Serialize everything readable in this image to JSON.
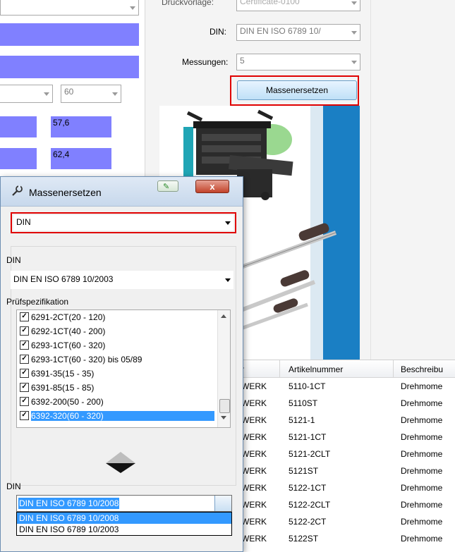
{
  "background": {
    "druckvorlage_label": "Druckvorlage:",
    "druckvorlage_value": "Certificate-0100",
    "din_label": "DIN:",
    "din_value": "DIN EN ISO 6789 10/",
    "messungen_label": "Messungen:",
    "messungen_value": "5",
    "massenersetzen_button": "Massenersetzen",
    "left_combo_value": "60",
    "left_values": [
      "57,6",
      "62,4"
    ]
  },
  "table": {
    "columns": [
      "r",
      "Artikelnummer",
      "Beschreibu"
    ],
    "rows": [
      {
        "c1": "WERK",
        "c2": "5110-1CT",
        "c3": "Drehmome"
      },
      {
        "c1": "WERK",
        "c2": "5110ST",
        "c3": "Drehmome"
      },
      {
        "c1": "WERK",
        "c2": "5121-1",
        "c3": "Drehmome"
      },
      {
        "c1": "WERK",
        "c2": "5121-1CT",
        "c3": "Drehmome"
      },
      {
        "c1": "WERK",
        "c2": "5121-2CLT",
        "c3": "Drehmome"
      },
      {
        "c1": "WERK",
        "c2": "5121ST",
        "c3": "Drehmome"
      },
      {
        "c1": "WERK",
        "c2": "5122-1CT",
        "c3": "Drehmome"
      },
      {
        "c1": "WERK",
        "c2": "5122-2CLT",
        "c3": "Drehmome"
      },
      {
        "c1": "WERK",
        "c2": "5122-2CT",
        "c3": "Drehmome"
      },
      {
        "c1": "WERK",
        "c2": "5122ST",
        "c3": "Drehmome"
      }
    ]
  },
  "dialog": {
    "title": "Massenersetzen",
    "close_label": "x",
    "type_select": "DIN",
    "source_label": "DIN",
    "source_value": "DIN EN ISO 6789 10/2003",
    "spec_label": "Prüfspezifikation",
    "specs": [
      "6291-2CT(20 - 120)",
      "6292-1CT(40 - 200)",
      "6293-1CT(60 - 320)",
      "6293-1CT(60 - 320) bis 05/89",
      "6391-35(15 - 35)",
      "6391-85(15 - 85)",
      "6392-200(50 - 200)",
      "6392-320(60 - 320)"
    ],
    "target_label": "DIN",
    "target_value": "DIN EN ISO 6789 10/2008",
    "dropdown_options": [
      "DIN EN ISO 6789 10/2008",
      "DIN EN ISO 6789 10/2003"
    ]
  },
  "colors": {
    "accent_red": "#e00000",
    "selection_blue": "#3399ff",
    "purple_fill": "#8080ff"
  }
}
